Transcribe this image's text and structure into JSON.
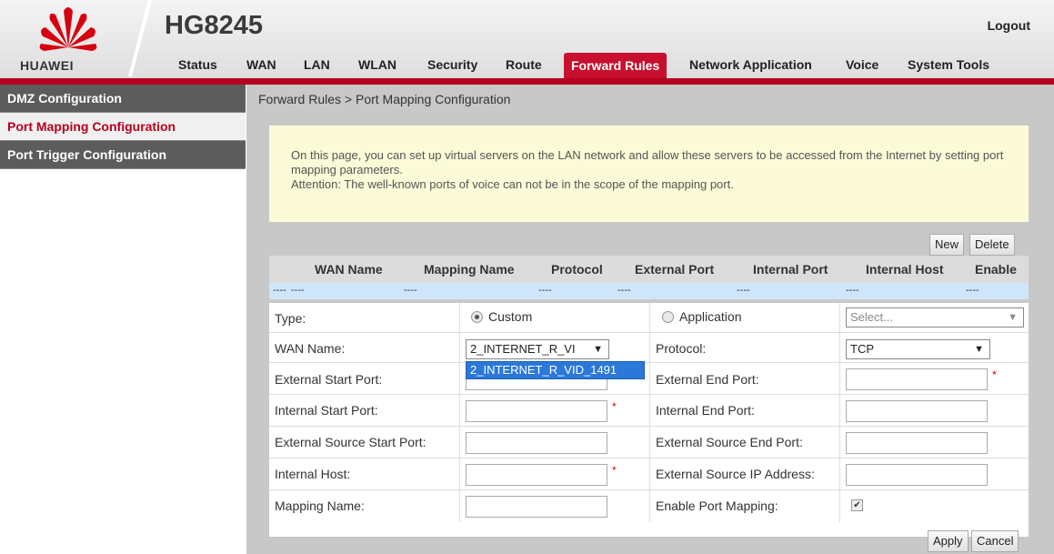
{
  "brand": {
    "logo_text": "HUAWEI",
    "model": "HG8245",
    "logout": "Logout"
  },
  "nav": [
    "Status",
    "WAN",
    "LAN",
    "WLAN",
    "Security",
    "Route",
    "Forward Rules",
    "Network Application",
    "Voice",
    "System Tools"
  ],
  "nav_active": "Forward Rules",
  "sidebar": [
    "DMZ Configuration",
    "Port Mapping Configuration",
    "Port Trigger Configuration"
  ],
  "breadcrumb": "Forward Rules > Port Mapping Configuration",
  "notice": {
    "line1": "On this page, you can set up virtual servers on the LAN network and allow these servers to be accessed from the Internet by setting port mapping parameters.",
    "line2": "Attention: The well-known ports of voice can not be in the scope of the mapping port."
  },
  "buttons": {
    "new": "New",
    "delete": "Delete",
    "apply": "Apply",
    "cancel": "Cancel"
  },
  "table": {
    "headers": [
      "WAN Name",
      "Mapping Name",
      "Protocol",
      "External Port",
      "Internal Port",
      "Internal Host",
      "Enable"
    ],
    "row": [
      "----",
      "----",
      "----",
      "----",
      "----",
      "----",
      "----",
      "----",
      "----"
    ]
  },
  "form": {
    "type_label": "Type:",
    "type_custom": "Custom",
    "type_application": "Application",
    "app_select": "Select...",
    "wan_name_label": "WAN Name:",
    "wan_name_value": "2_INTERNET_R_VI",
    "wan_dropdown_option": "2_INTERNET_R_VID_1491",
    "protocol_label": "Protocol:",
    "protocol_value": "TCP",
    "ext_start_label": "External Start Port:",
    "ext_end_label": "External End Port:",
    "int_start_label": "Internal Start Port:",
    "int_end_label": "Internal End Port:",
    "ext_src_start_label": "External Source Start Port:",
    "ext_src_end_label": "External Source End Port:",
    "int_host_label": "Internal Host:",
    "ext_src_ip_label": "External Source IP Address:",
    "mapping_name_label": "Mapping Name:",
    "enable_label": "Enable Port Mapping:",
    "required_mark": "*",
    "enable_checked": true,
    "custom_selected": true
  },
  "colors": {
    "brand_red": "#b5001f",
    "notice_bg": "#fbfbd8",
    "dropdown_highlight": "#2b78d8"
  }
}
